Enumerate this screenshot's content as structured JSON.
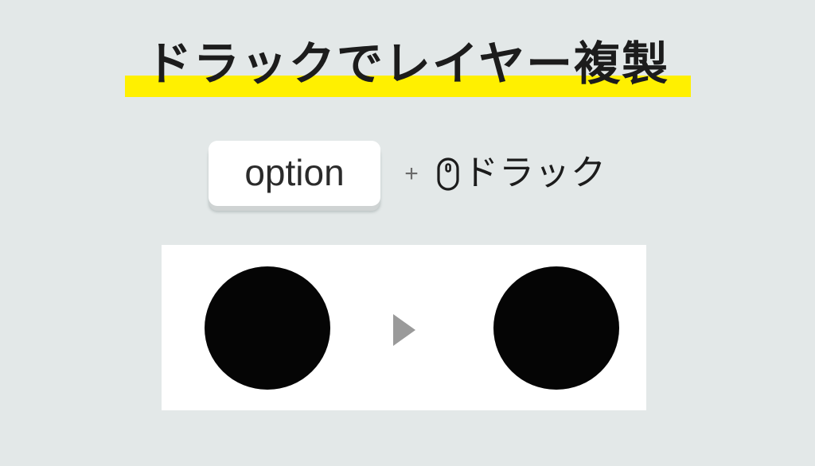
{
  "slide": {
    "background_color": "#e3e8e8",
    "title": {
      "text": "ドラックでレイヤー複製",
      "highlight_color": "#fff000",
      "text_color": "#1c1c1c"
    },
    "shortcut": {
      "key_label": "option",
      "key_color": "#ffffff",
      "plus_symbol": "+",
      "mouse_icon_name": "mouse-icon",
      "action_label": "ドラック"
    },
    "illustration": {
      "panel_color": "#ffffff",
      "shape_color": "#050505",
      "arrow_color": "#9a9a9a",
      "arrow_icon_name": "right-triangle-icon",
      "original_shape_name": "circle",
      "duplicate_shape_name": "circle"
    }
  }
}
